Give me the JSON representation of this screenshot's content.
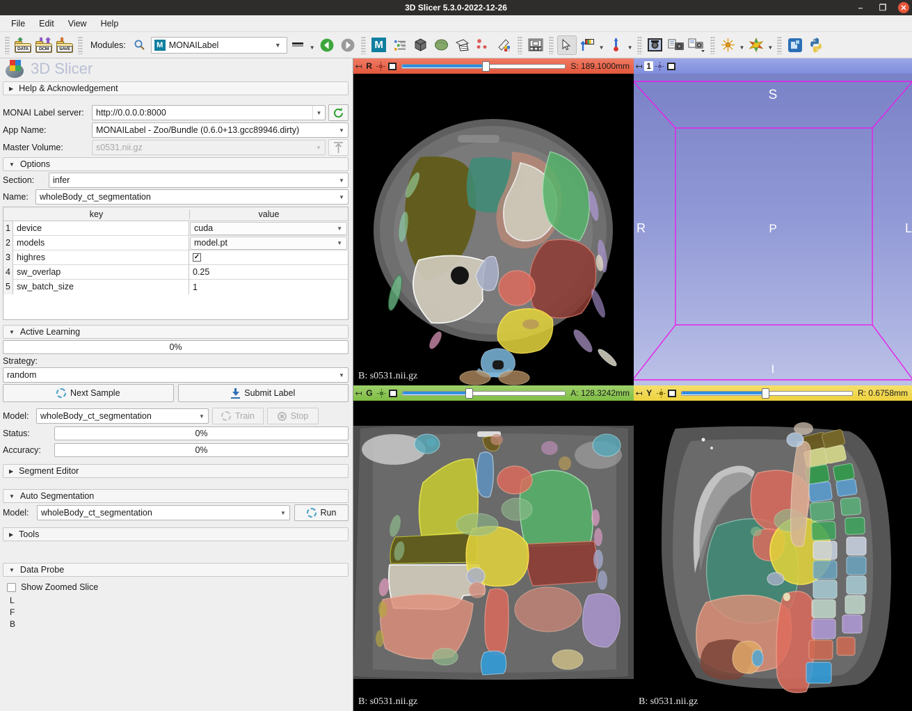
{
  "window": {
    "title": "3D Slicer 5.3.0-2022-12-26",
    "minimize_icon": "–",
    "maximize_icon": "❐",
    "close_icon": "✕"
  },
  "menubar": {
    "items": [
      {
        "label": "File"
      },
      {
        "label": "Edit"
      },
      {
        "label": "View"
      },
      {
        "label": "Help"
      }
    ]
  },
  "toolbar": {
    "data_label": "DATA",
    "dcm_label": "DCM",
    "save_label": "SAVE",
    "modules_label": "Modules:",
    "search_icon": "search-icon",
    "module_value": "MONAILabel",
    "module_badge": "M",
    "icons": [
      "monai-label-icon",
      "subject-hierarchy-icon",
      "volume-rendering-icon",
      "models-icon",
      "transforms-icon",
      "markups-icon",
      "annotations-icon",
      "layout-icon",
      "mouse-pointer-icon",
      "window-level-icon",
      "crosshair-icon",
      "capture-icon",
      "screenshot-icon",
      "screen-capture-icon",
      "fiducial-icon",
      "color-icon",
      "extension-manager-icon",
      "python-console-icon"
    ]
  },
  "panel": {
    "brand": "3D Slicer",
    "help_section": "Help & Acknowledgement",
    "server_label": "MONAI Label server:",
    "server_value": "http://0.0.0.0:8000",
    "refresh_icon": "refresh-icon",
    "app_name_label": "App Name:",
    "app_name_value": "MONAILabel - Zoo/Bundle (0.6.0+13.gcc89946.dirty)",
    "master_volume_label": "Master Volume:",
    "master_volume_value": "s0531.nii.gz",
    "upload_icon": "upload-icon",
    "options_section": "Options",
    "section_label": "Section:",
    "section_value": "infer",
    "name_label": "Name:",
    "name_value": "wholeBody_ct_segmentation",
    "table": {
      "headers": [
        "key",
        "value"
      ],
      "rows": [
        {
          "n": "1",
          "key": "device",
          "value": "cuda",
          "type": "combo"
        },
        {
          "n": "2",
          "key": "models",
          "value": "model.pt",
          "type": "combo"
        },
        {
          "n": "3",
          "key": "highres",
          "value": "✓",
          "type": "check"
        },
        {
          "n": "4",
          "key": "sw_overlap",
          "value": "0.25",
          "type": "text"
        },
        {
          "n": "5",
          "key": "sw_batch_size",
          "value": "1",
          "type": "text"
        }
      ]
    },
    "active_learning_section": "Active Learning",
    "active_learning_progress": "0%",
    "strategy_label": "Strategy:",
    "strategy_value": "random",
    "next_sample_button": "Next Sample",
    "submit_label_button": "Submit Label",
    "train_model_label": "Model:",
    "train_model_value": "wholeBody_ct_segmentation",
    "train_button": "Train",
    "stop_button": "Stop",
    "status_label": "Status:",
    "status_value": "0%",
    "accuracy_label": "Accuracy:",
    "accuracy_value": "0%",
    "segment_editor_section": "Segment Editor",
    "auto_segmentation_section": "Auto Segmentation",
    "auto_model_label": "Model:",
    "auto_model_value": "wholeBody_ct_segmentation",
    "run_button": "Run",
    "tools_section": "Tools",
    "data_probe_section": "Data Probe",
    "show_zoomed_slice": "Show Zoomed Slice",
    "probe_lines": [
      "L",
      "F",
      "B"
    ]
  },
  "views": {
    "red": {
      "letter": "R",
      "pin_icon": "pin-icon",
      "reticle_icon": "reticle-icon",
      "maximize_icon": "maximize-view-icon",
      "slider_percent": 52,
      "position": "S: 189.1000mm",
      "volume_label": "B: s0531.nii.gz",
      "accent": "#e4573c"
    },
    "threed": {
      "letter": "1",
      "pin_icon": "pin-icon",
      "reticle_icon": "reticle-icon",
      "maximize_icon": "maximize-view-icon",
      "axes": {
        "superior": "S",
        "inferior": "I",
        "right": "R",
        "left": "L",
        "posterior": "P"
      },
      "accent": "#7f8ddc",
      "box_color": "#e81de8"
    },
    "green": {
      "letter": "G",
      "pin_icon": "pin-icon",
      "reticle_icon": "reticle-icon",
      "maximize_icon": "maximize-view-icon",
      "slider_percent": 42,
      "position": "A: 128.3242mm",
      "volume_label": "B: s0531.nii.gz",
      "accent": "#7fbd45"
    },
    "yellow": {
      "letter": "Y",
      "pin_icon": "pin-icon",
      "reticle_icon": "reticle-icon",
      "maximize_icon": "maximize-view-icon",
      "slider_percent": 50,
      "position": "R: 0.6758mm",
      "volume_label": "B: s0531.nii.gz",
      "accent": "#edd13f"
    }
  },
  "segmentation_colors": {
    "lung_upper_lobe_left": "#d8d83c",
    "lung_lower_lobe_left": "#5c5c12",
    "lung_upper_lobe_right": "#56b36b",
    "lung_lower_lobe_right": "#8e3b34",
    "liver": "#cfcaba",
    "spleen": "#3e8c77",
    "stomach": "#c7a898",
    "heart": "#e0d23c",
    "aorta": "#e06b5c",
    "vertebrae": "#7db8dd",
    "kidney": "#d98d73",
    "esophagus": "#a9b0c8",
    "trachea": "#6aa8d4",
    "autochthon": "#b08a5f",
    "ribs_purple": "#b09ad8"
  }
}
